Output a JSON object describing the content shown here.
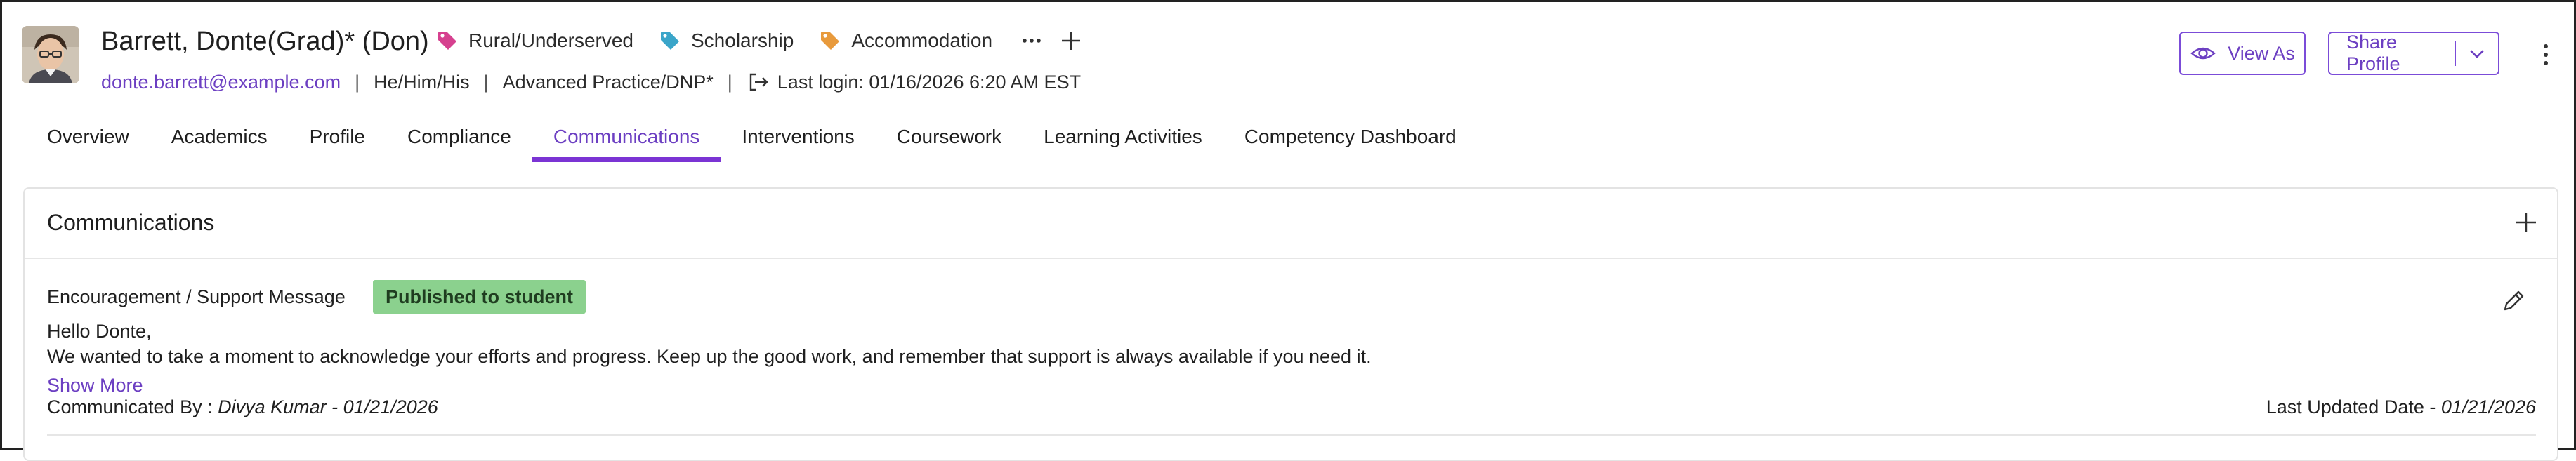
{
  "student": {
    "name": "Barrett, Donte(Grad)* (Don)",
    "email": "donte.barrett@example.com",
    "pronouns": "He/Him/His",
    "program": "Advanced Practice/DNP*",
    "last_login": "Last login: 01/16/2026 6:20 AM EST",
    "separator": "|"
  },
  "tags": [
    {
      "label": "Rural/Underserved",
      "color": "#d6408f"
    },
    {
      "label": "Scholarship",
      "color": "#3aa5c9"
    },
    {
      "label": "Accommodation",
      "color": "#e89a3c"
    }
  ],
  "header_actions": {
    "view_as": "View As",
    "share_profile": "Share Profile"
  },
  "tabs": [
    {
      "label": "Overview",
      "active": false
    },
    {
      "label": "Academics",
      "active": false
    },
    {
      "label": "Profile",
      "active": false
    },
    {
      "label": "Compliance",
      "active": false
    },
    {
      "label": "Communications",
      "active": true
    },
    {
      "label": "Interventions",
      "active": false
    },
    {
      "label": "Coursework",
      "active": false
    },
    {
      "label": "Learning Activities",
      "active": false
    },
    {
      "label": "Competency Dashboard",
      "active": false
    }
  ],
  "communications": {
    "title": "Communications",
    "entries": [
      {
        "type": "Encouragement / Support Message",
        "status": "Published to student",
        "greeting": "Hello Donte,",
        "message": "We wanted to take a moment to acknowledge your efforts and progress. Keep up the good work, and remember that support is always available if you need it.",
        "show_more": "Show More",
        "communicated_by_label": "Communicated By : ",
        "communicated_by_value": "Divya Kumar - 01/21/2026",
        "last_updated_label": "Last Updated Date - ",
        "last_updated_value": "01/21/2026"
      }
    ]
  },
  "colors": {
    "accent": "#6c3fc2",
    "active_tab_underline": "#7b34d4",
    "status_badge_bg": "#8bd18e"
  }
}
